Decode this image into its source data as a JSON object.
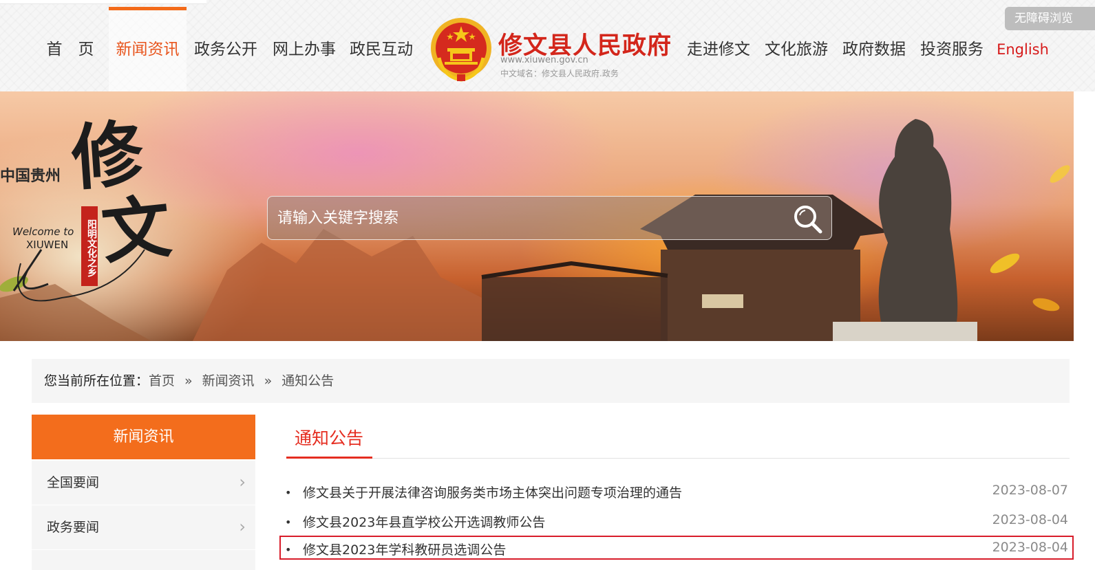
{
  "accessibility_label": "无障碍浏览",
  "nav_left": [
    "首　页",
    "新闻资讯",
    "政务公开",
    "网上办事",
    "政民互动"
  ],
  "nav_right": [
    "走进修文",
    "文化旅游",
    "政府数据",
    "投资服务",
    "English"
  ],
  "active_nav": "新闻资讯",
  "site": {
    "title": "修文县人民政府",
    "url": "www.xiuwen.gov.cn",
    "cn_domain": "中文域名：修文县人民政府.政务"
  },
  "banner": {
    "region": "中国贵州",
    "big_chars": [
      "修",
      "文"
    ],
    "welcome": "Welcome to",
    "name_en": "XIUWEN",
    "seal": "阳明文化之乡"
  },
  "search": {
    "placeholder": "请输入关键字搜索"
  },
  "breadcrumb": {
    "prefix": "您当前所在位置：",
    "items": [
      "首页",
      "新闻资讯",
      "通知公告"
    ],
    "separator": "»"
  },
  "sidebar": {
    "header": "新闻资讯",
    "items": [
      "全国要闻",
      "政务要闻"
    ]
  },
  "section": {
    "title": "通知公告",
    "news": [
      {
        "title": "修文县关于开展法律咨询服务类市场主体突出问题专项治理的通告",
        "date": "2023-08-07"
      },
      {
        "title": "修文县2023年县直学校公开选调教师公告",
        "date": "2023-08-04"
      },
      {
        "title": "修文县2023年学科教研员选调公告",
        "date": "2023-08-04"
      }
    ]
  },
  "colors": {
    "accent_orange": "#f36d1c",
    "brand_red": "#d3261b",
    "highlight_border": "#d81c2a"
  }
}
